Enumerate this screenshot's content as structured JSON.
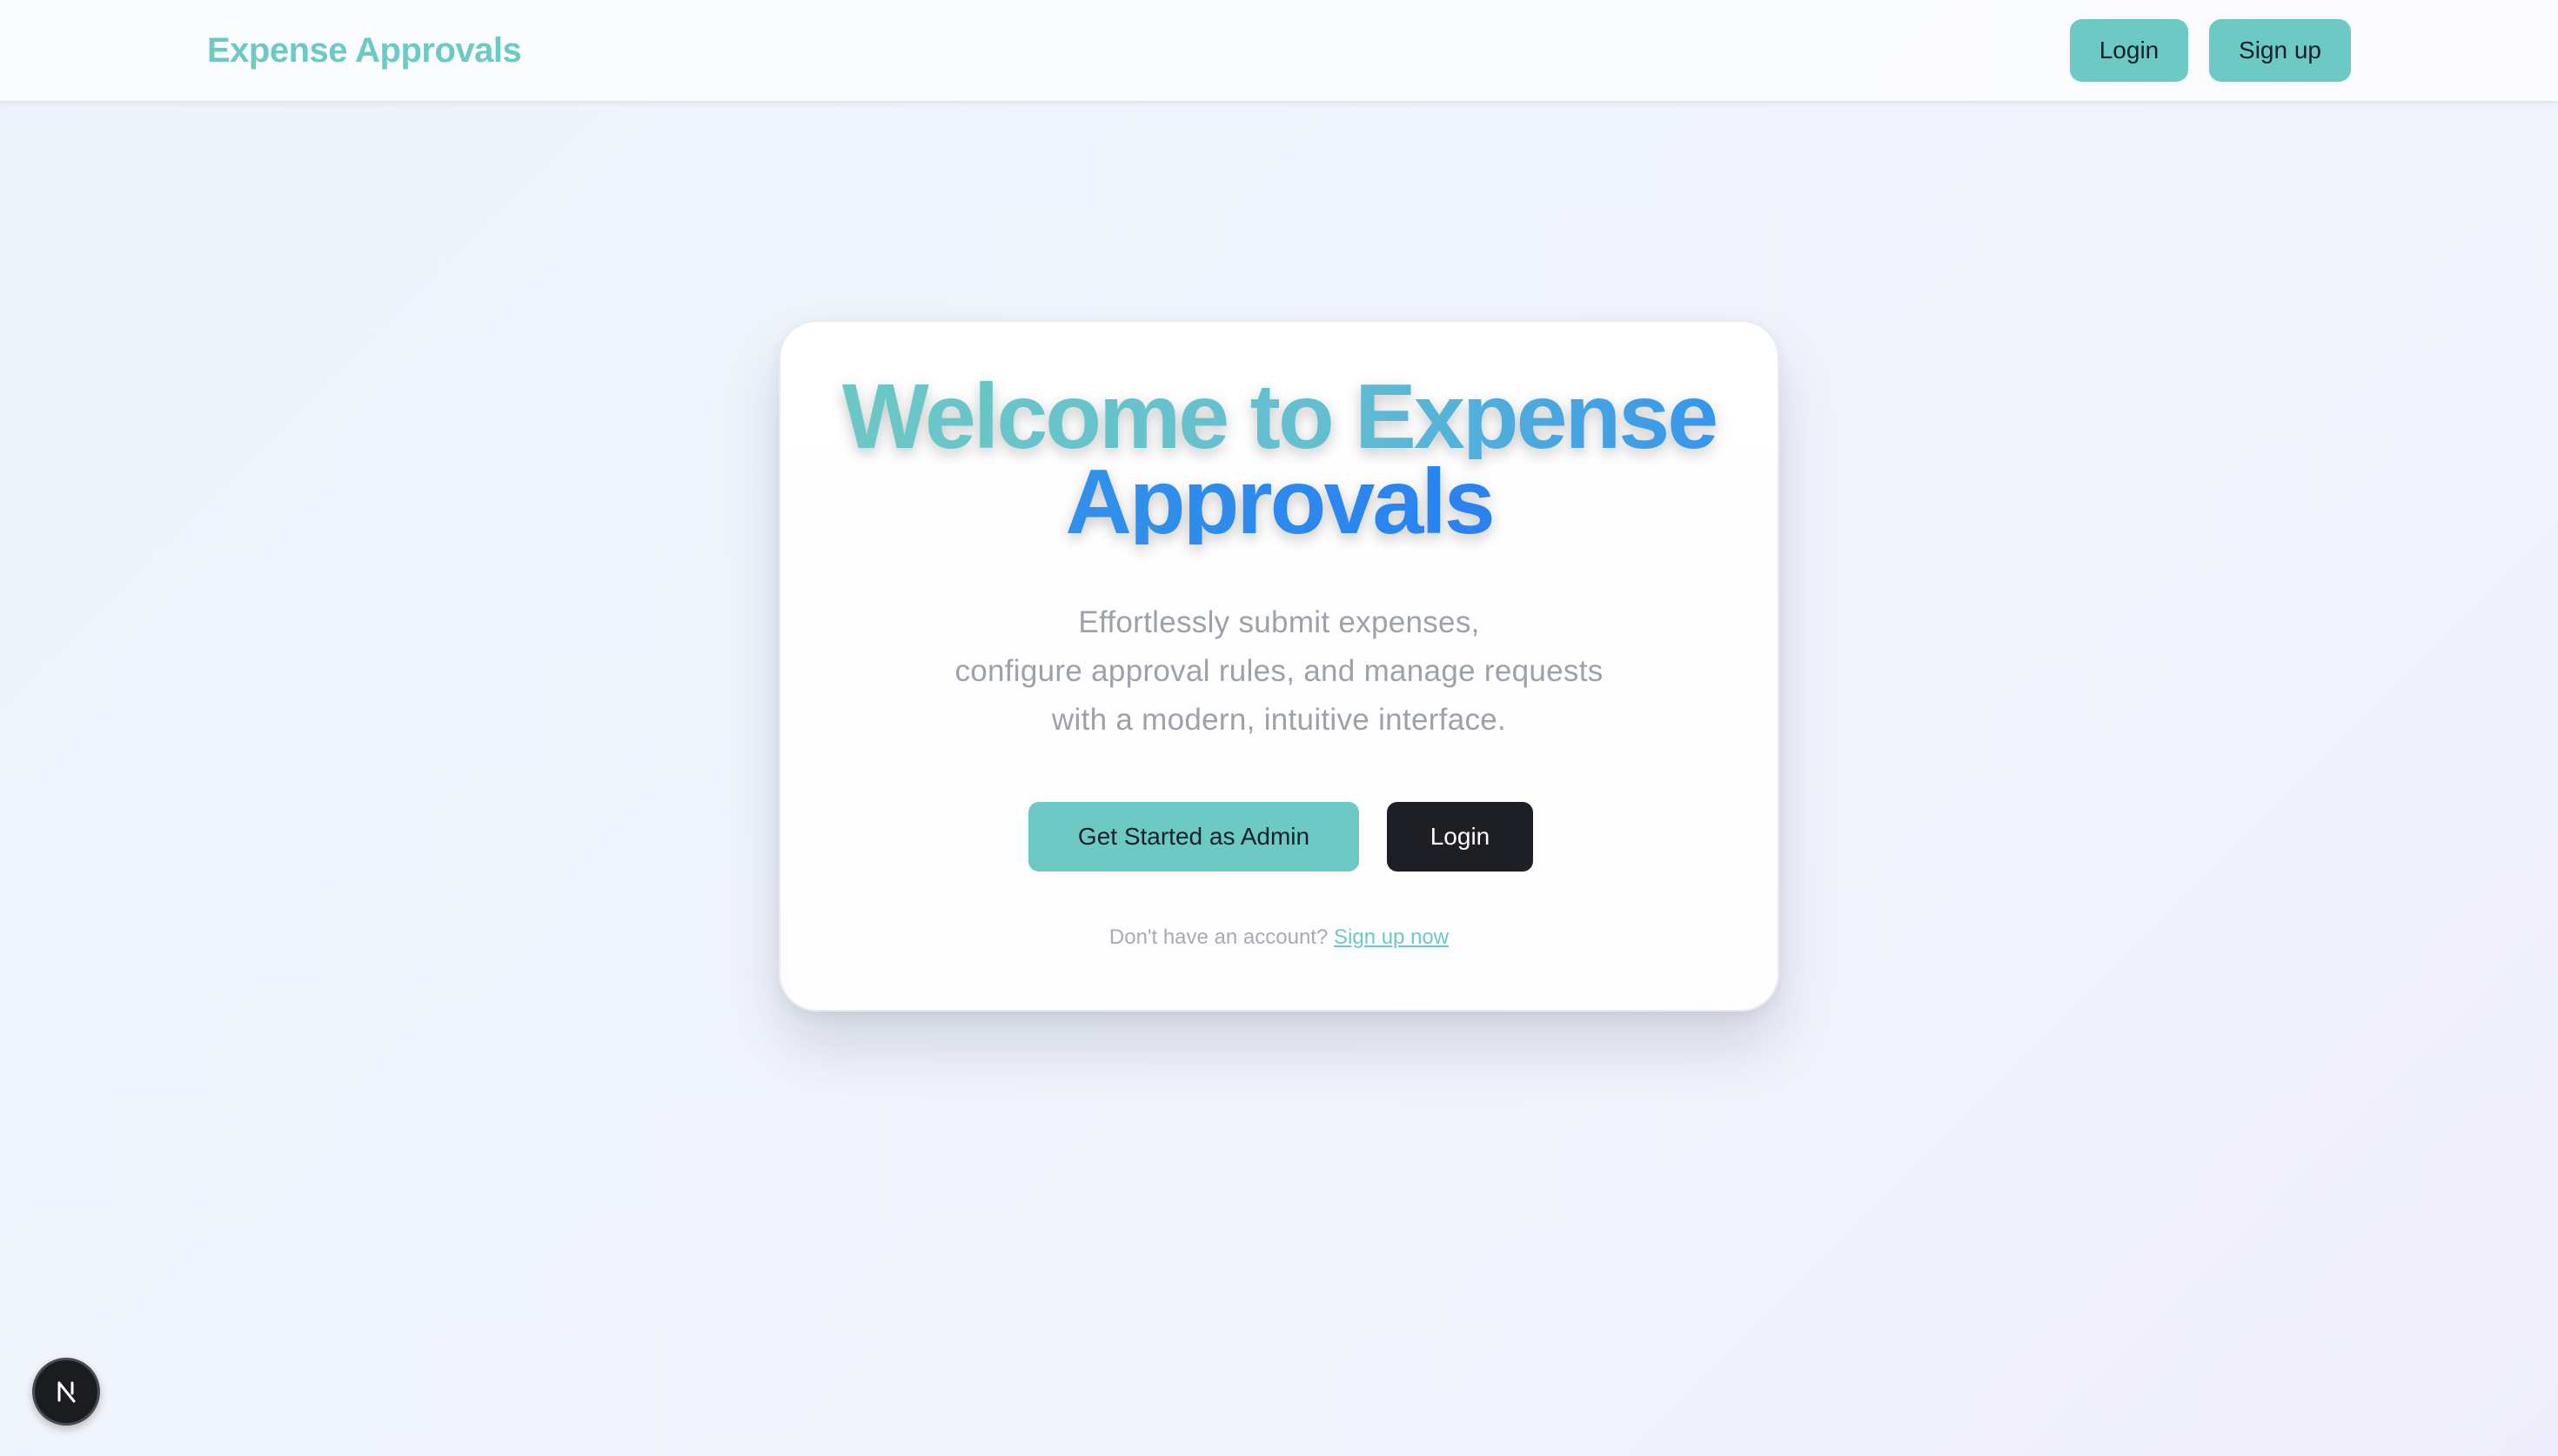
{
  "theme": {
    "accent": "#6cc9c4",
    "dark_button": "#1e1f24"
  },
  "header": {
    "brand": "Expense Approvals",
    "login_label": "Login",
    "signup_label": "Sign up"
  },
  "hero": {
    "title_line1": "Welcome to Expense",
    "title_line2": "Approvals",
    "subtitle_lines": [
      "Effortlessly submit expenses,",
      "configure approval rules, and manage requests",
      "with a modern, intuitive interface."
    ],
    "primary_button": "Get Started as Admin",
    "secondary_button": "Login",
    "signup_prompt": "Don't have an account?",
    "signup_link": "Sign up now"
  },
  "badge": {
    "icon": "nextjs-logo-icon",
    "letter": "N"
  }
}
